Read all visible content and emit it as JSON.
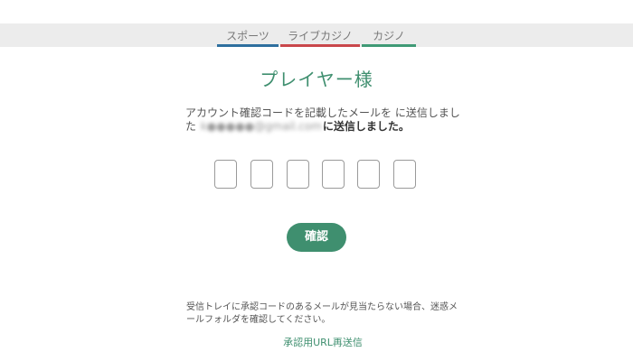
{
  "nav": {
    "tabs": [
      {
        "label": "スポーツ",
        "color": "#2e6f9e"
      },
      {
        "label": "ライブカジノ",
        "color": "#c9474b"
      },
      {
        "label": "カジノ",
        "color": "#3f9a76"
      }
    ]
  },
  "main": {
    "title": "プレイヤー様",
    "message_line1": "アカウント確認コードを記載したメールを に送信しまし",
    "message_line2_prefix": "た",
    "email": "k●●●●●@gmail.com",
    "message_line2_suffix": "に送信しました。",
    "code_digits": [
      "",
      "",
      "",
      "",
      "",
      ""
    ],
    "confirm_label": "確認"
  },
  "footer": {
    "note_line1": "受信トレイに承認コードのあるメールが見当たらない場合、迷惑メ",
    "note_line2": "ールフォルダを確認してください。",
    "resend_label": "承認用URL再送信"
  },
  "colors": {
    "accent": "#3f8f6f",
    "nav_bg": "#ececec"
  }
}
